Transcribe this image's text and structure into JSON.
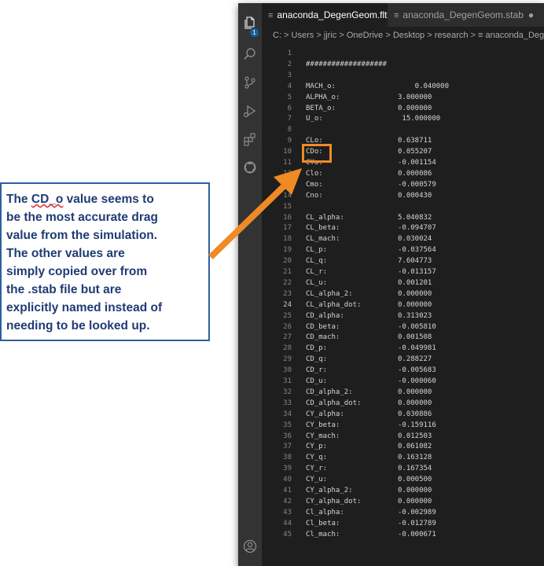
{
  "editor": {
    "tabs": [
      {
        "label": "anaconda_DegenGeom.flt",
        "close": "×",
        "active": true
      },
      {
        "label": "anaconda_DegenGeom.stab",
        "close": "●",
        "active": false
      }
    ],
    "breadcrumb": "C: > Users > jjric > OneDrive > Desktop > research > ≡ anaconda_DegenGe",
    "activity_badge": "1",
    "current_line": "24",
    "lines": [
      {
        "n": "1",
        "label": "",
        "value": ""
      },
      {
        "n": "2",
        "label": "###################",
        "value": ""
      },
      {
        "n": "3",
        "label": "",
        "value": ""
      },
      {
        "n": "4",
        "label": "MACH_o:",
        "value": "    0.040000"
      },
      {
        "n": "5",
        "label": "ALPHA_o:",
        "value": "3.000000"
      },
      {
        "n": "6",
        "label": "BETA_o:",
        "value": "0.000000"
      },
      {
        "n": "7",
        "label": "U_o:",
        "value": " 15.000000"
      },
      {
        "n": "8",
        "label": "",
        "value": ""
      },
      {
        "n": "9",
        "label": "CLo:",
        "value": "0.638711"
      },
      {
        "n": "10",
        "label": "CDo:",
        "value": "0.055207"
      },
      {
        "n": "11",
        "label": "CYo:",
        "value": "-0.001154"
      },
      {
        "n": "12",
        "label": "Clo:",
        "value": "0.000086"
      },
      {
        "n": "13",
        "label": "Cmo:",
        "value": "-0.000579"
      },
      {
        "n": "14",
        "label": "Cno:",
        "value": "0.000430"
      },
      {
        "n": "15",
        "label": "",
        "value": ""
      },
      {
        "n": "16",
        "label": "CL_alpha:",
        "value": "5.040832"
      },
      {
        "n": "17",
        "label": "CL_beta:",
        "value": "-0.094707"
      },
      {
        "n": "18",
        "label": "CL_mach:",
        "value": "0.030024"
      },
      {
        "n": "19",
        "label": "CL_p:",
        "value": "-0.037564"
      },
      {
        "n": "20",
        "label": "CL_q:",
        "value": "7.604773"
      },
      {
        "n": "21",
        "label": "CL_r:",
        "value": "-0.013157"
      },
      {
        "n": "22",
        "label": "CL_u:",
        "value": "0.001201"
      },
      {
        "n": "23",
        "label": "CL_alpha_2:",
        "value": "0.000000"
      },
      {
        "n": "24",
        "label": "CL_alpha_dot:",
        "value": "0.000000"
      },
      {
        "n": "25",
        "label": "CD_alpha:",
        "value": "0.313023"
      },
      {
        "n": "26",
        "label": "CD_beta:",
        "value": "-0.005810"
      },
      {
        "n": "27",
        "label": "CD_mach:",
        "value": "0.001508"
      },
      {
        "n": "28",
        "label": "CD_p:",
        "value": "-0.049981"
      },
      {
        "n": "29",
        "label": "CD_q:",
        "value": "0.288227"
      },
      {
        "n": "30",
        "label": "CD_r:",
        "value": "-0.005683"
      },
      {
        "n": "31",
        "label": "CD_u:",
        "value": "-0.000060"
      },
      {
        "n": "32",
        "label": "CD_alpha_2:",
        "value": "0.000000"
      },
      {
        "n": "33",
        "label": "CD_alpha_dot:",
        "value": "0.000000"
      },
      {
        "n": "34",
        "label": "CY_alpha:",
        "value": "0.030886"
      },
      {
        "n": "35",
        "label": "CY_beta:",
        "value": "-0.159116"
      },
      {
        "n": "36",
        "label": "CY_mach:",
        "value": "0.012503"
      },
      {
        "n": "37",
        "label": "CY_p:",
        "value": "0.061082"
      },
      {
        "n": "38",
        "label": "CY_q:",
        "value": "0.163128"
      },
      {
        "n": "39",
        "label": "CY_r:",
        "value": "0.167354"
      },
      {
        "n": "40",
        "label": "CY_u:",
        "value": "0.000500"
      },
      {
        "n": "41",
        "label": "CY_alpha_2:",
        "value": "0.000000"
      },
      {
        "n": "42",
        "label": "CY_alpha_dot:",
        "value": "0.000000"
      },
      {
        "n": "43",
        "label": "Cl_alpha:",
        "value": "-0.002989"
      },
      {
        "n": "44",
        "label": "Cl_beta:",
        "value": "-0.012789"
      },
      {
        "n": "45",
        "label": "Cl_mach:",
        "value": "-0.000671"
      }
    ]
  },
  "callout": {
    "lines": [
      {
        "pre": "The ",
        "mark": "CD_o",
        "post": " value seems to"
      },
      {
        "pre": "be the most accurate drag",
        "mark": "",
        "post": ""
      },
      {
        "pre": "value from the simulation.",
        "mark": "",
        "post": ""
      },
      {
        "pre": "The other values are",
        "mark": "",
        "post": ""
      },
      {
        "pre": "simply copied over from",
        "mark": "",
        "post": ""
      },
      {
        "pre": "the .stab file but are",
        "mark": "",
        "post": ""
      },
      {
        "pre": "explicitly named instead of",
        "mark": "",
        "post": ""
      },
      {
        "pre": "needing to be looked up.",
        "mark": "",
        "post": ""
      }
    ]
  },
  "colors": {
    "highlight": "#f08a24",
    "callout_text": "#1f3c74",
    "callout_border": "#2e5f9e",
    "editor_bg": "#1e1e1e"
  }
}
